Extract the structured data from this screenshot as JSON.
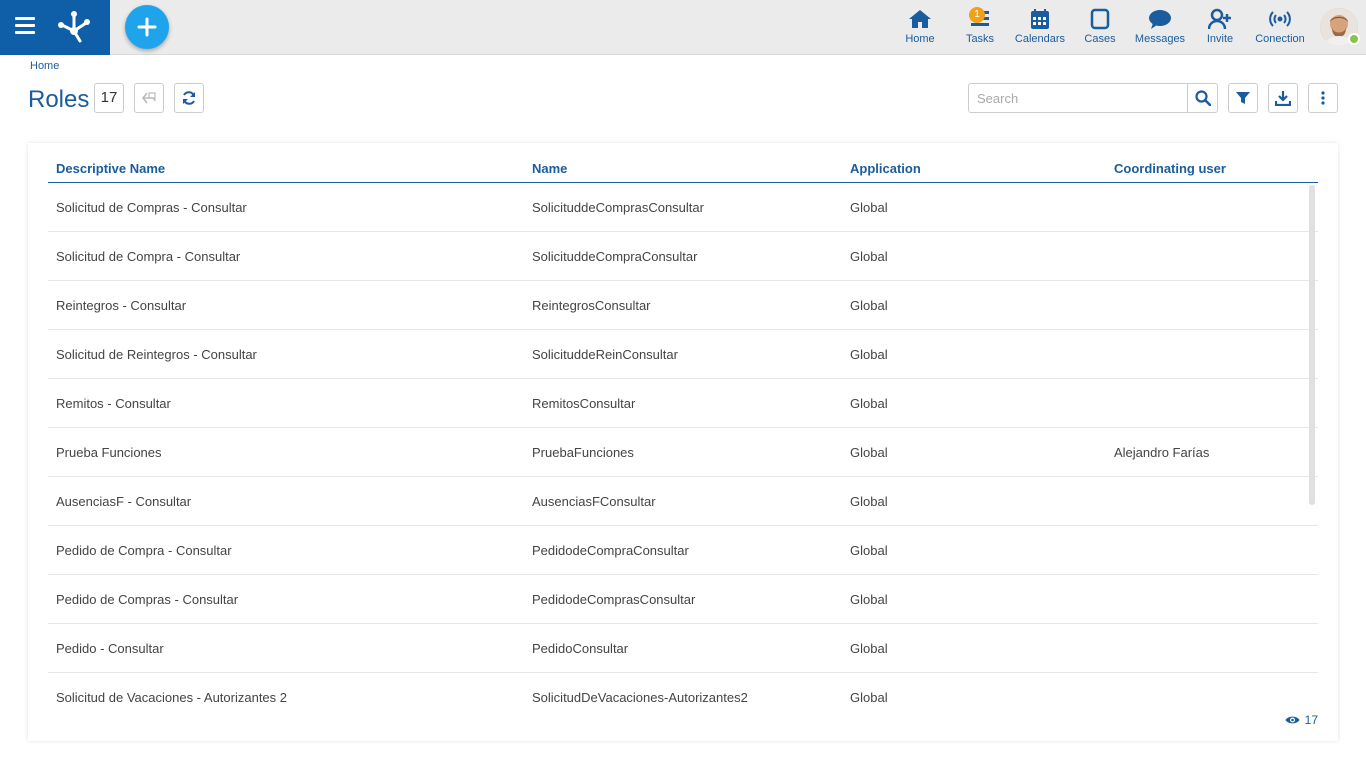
{
  "topbar": {
    "nav": [
      {
        "label": "Home",
        "icon": "home-icon"
      },
      {
        "label": "Tasks",
        "icon": "tasks-icon",
        "badge": "1"
      },
      {
        "label": "Calendars",
        "icon": "calendar-icon"
      },
      {
        "label": "Cases",
        "icon": "cases-icon"
      },
      {
        "label": "Messages",
        "icon": "messages-icon"
      },
      {
        "label": "Invite",
        "icon": "invite-icon"
      },
      {
        "label": "Conection",
        "icon": "connection-icon"
      }
    ],
    "accent": "#0f5ea8",
    "add_button_color": "#1fa3ea"
  },
  "breadcrumb": "Home",
  "page": {
    "title": "Roles",
    "count": "17"
  },
  "search": {
    "placeholder": "Search",
    "value": ""
  },
  "table": {
    "columns": [
      "Descriptive Name",
      "Name",
      "Application",
      "Coordinating user"
    ],
    "rows": [
      [
        "Solicitud de Compras - Consultar",
        "SolicituddeComprasConsultar",
        "Global",
        ""
      ],
      [
        "Solicitud de Compra - Consultar",
        "SolicituddeCompraConsultar",
        "Global",
        ""
      ],
      [
        "Reintegros - Consultar",
        "ReintegrosConsultar",
        "Global",
        ""
      ],
      [
        "Solicitud de Reintegros - Consultar",
        "SolicituddeReinConsultar",
        "Global",
        ""
      ],
      [
        "Remitos - Consultar",
        "RemitosConsultar",
        "Global",
        ""
      ],
      [
        "Prueba Funciones",
        "PruebaFunciones",
        "Global",
        "Alejandro Farías"
      ],
      [
        "AusenciasF - Consultar",
        "AusenciasFConsultar",
        "Global",
        ""
      ],
      [
        "Pedido de Compra - Consultar",
        "PedidodeCompraConsultar",
        "Global",
        ""
      ],
      [
        "Pedido de Compras - Consultar",
        "PedidodeComprasConsultar",
        "Global",
        ""
      ],
      [
        "Pedido - Consultar",
        "PedidoConsultar",
        "Global",
        ""
      ],
      [
        "Solicitud de Vacaciones - Autorizantes 2",
        "SolicitudDeVacaciones-Autorizantes2",
        "Global",
        ""
      ]
    ],
    "footer_count": "17"
  }
}
